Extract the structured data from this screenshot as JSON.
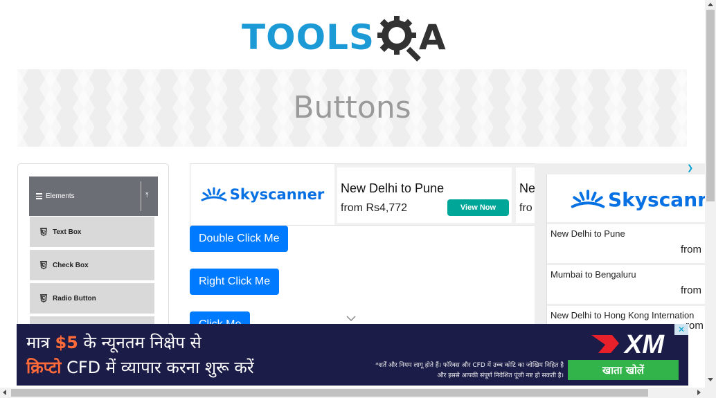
{
  "header": {
    "logo_text": "TOOLS",
    "logo_letter": "A"
  },
  "banner": {
    "title": "Buttons"
  },
  "sidebar": {
    "group": {
      "label": "Elements"
    },
    "items": [
      {
        "label": "Text Box"
      },
      {
        "label": "Check Box"
      },
      {
        "label": "Radio Button"
      }
    ]
  },
  "buttons": {
    "double_click": "Double Click Me",
    "right_click": "Right Click Me",
    "click": "Click Me"
  },
  "ad_inline": {
    "brand": "Skyscanner",
    "route": "New Delhi to Pune",
    "price": "from Rs4,772",
    "cta": "View Now",
    "route2": "Ne",
    "price2": "fro"
  },
  "ad_side": {
    "brand": "Skyscann",
    "rows": [
      {
        "route": "New Delhi to Pune",
        "from": "from"
      },
      {
        "route": "Mumbai to Bengaluru",
        "from": "from"
      },
      {
        "route": "New Delhi to Hong Kong Internation",
        "from": "rom"
      }
    ]
  },
  "ad_bottom": {
    "line1_prefix": "मात्र ",
    "line1_amount": "$5",
    "line1_suffix": " के न्यूनतम निक्षेप से",
    "line2_highlight": "क्रिप्टो",
    "line2_rest": " CFD में व्यापार करना शुरू करें",
    "disclaimer": "*शर्तें और नियम लागू होते हैं। फॉरेक्स और CFD में उच्च कोटि का जोखिम निहित है और इससे आपकी संपूर्ण निवेशित पूंजी नष्ट हो सकती है।",
    "cta": "खाता खोलें",
    "brand": "XM"
  },
  "colors": {
    "primary_button": "#007bff",
    "logo_blue": "#1b9ad6",
    "skyscanner_blue": "#0770e3",
    "cta_teal": "#00a698",
    "xm_green": "#33b44a",
    "xm_red": "#e8202a",
    "ad_navy": "#1c1c48"
  }
}
